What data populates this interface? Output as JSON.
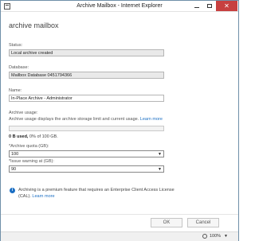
{
  "window": {
    "title": "Archive Mailbox - Internet Explorer",
    "minimize_glyph": "",
    "maximize_glyph": "",
    "close_glyph": "✕"
  },
  "page": {
    "title": "archive mailbox"
  },
  "form": {
    "status": {
      "label": "Status:",
      "value": "Local archive created"
    },
    "database": {
      "label": "Database:",
      "value": "Mailbox Database 0451794366"
    },
    "name": {
      "label": "Name:",
      "value": "In-Place Archive - Administrator"
    },
    "usage": {
      "label": "Archive usage:",
      "description": "Archive usage displays the archive storage limit and current usage.",
      "learn_more": "Learn more",
      "used": "0 B used,",
      "detail": " 0% of 100 GB.",
      "percent": 0
    },
    "quota": {
      "label": "*Archive quota (GB):",
      "value": "100"
    },
    "warning": {
      "label": "*Issue warning at (GB):",
      "value": "90"
    }
  },
  "info": {
    "text": "Archiving is a premium feature that requires an Enterprise Client Access License (CAL).",
    "learn_more": "Learn more"
  },
  "buttons": {
    "ok": "OK",
    "cancel": "Cancel"
  },
  "statusbar": {
    "zoom": "100%"
  },
  "colors": {
    "accent": "#1a6ec3",
    "close_button": "#c74040"
  }
}
